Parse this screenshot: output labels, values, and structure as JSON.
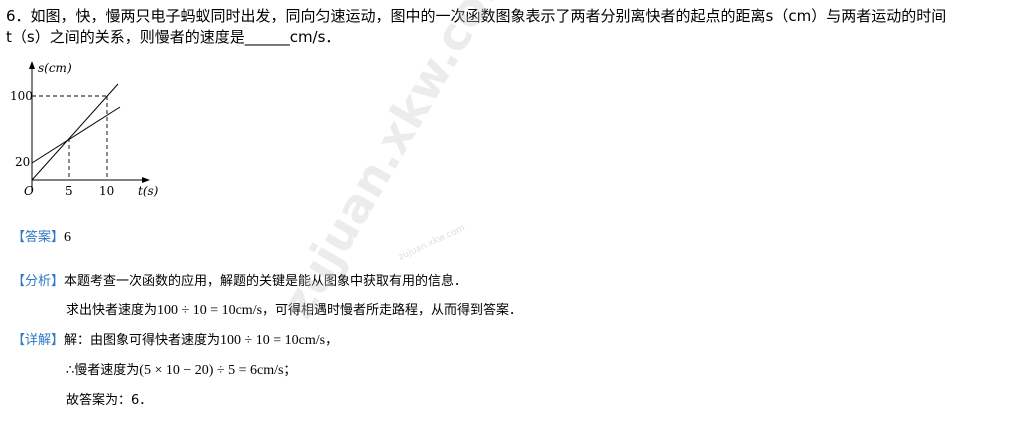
{
  "question": {
    "line1": "6．如图，快，慢两只电子蚂蚁同时出发，同向匀速运动，图中的一次函数图象表示了两者分别离快者的起点的距离s（cm）与两者运动的时间",
    "line2": "t（s）之间的关系，则慢者的速度是______cm/s．"
  },
  "graph": {
    "y_axis_label": "s(cm)",
    "x_axis_label": "t(s)",
    "origin_label": "O",
    "y_ticks": [
      "100",
      "20"
    ],
    "x_ticks": [
      "5",
      "10"
    ]
  },
  "answer": {
    "tag": "【答案】",
    "text": "6"
  },
  "analysis": {
    "tag": "【分析】",
    "line1": "本题考查一次函数的应用，解题的关键是能从图象中获取有用的信息．",
    "line2_prefix": "求出快者速度为",
    "line2_math": "100 ÷ 10 = 10cm/s",
    "line2_suffix": "，可得相遇时慢者所走路程，从而得到答案．"
  },
  "solution": {
    "tag": "【详解】",
    "line1_prefix": "解：由图象可得快者速度为",
    "line1_math": "100 ÷ 10 = 10cm/s",
    "line1_suffix": "，",
    "line2_prefix": "∴慢者速度为",
    "line2_math": "(5 × 10 − 20) ÷ 5 = 6cm/s",
    "line2_suffix": "；",
    "line3": "故答案为：6．"
  },
  "watermark": {
    "main": "zujuan.xkw.com",
    "small": "zujuan.xkw.com"
  }
}
